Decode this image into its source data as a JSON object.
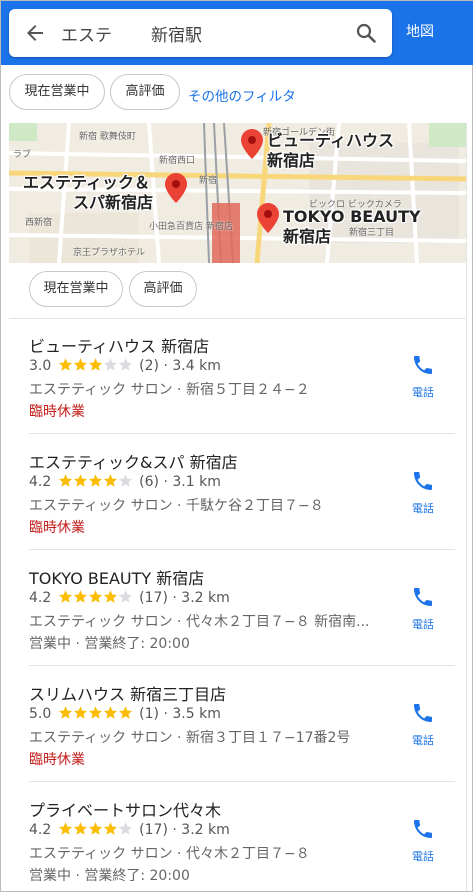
{
  "search": {
    "term": "エステ",
    "location": "新宿駅",
    "map_button": "地図"
  },
  "filters": {
    "open_now": "現在営業中",
    "top_rated": "高評価",
    "more": "その他のフィルタ"
  },
  "map": {
    "pins": [
      {
        "name": "ビューティハウス 新宿店",
        "line1": "ビューティハウス",
        "line2": "新宿店"
      },
      {
        "name": "エステティック＆ スパ新宿店",
        "line1": "エステティック＆",
        "line2": "スパ新宿店"
      },
      {
        "name": "TOKYO BEAUTY 新宿店",
        "line1": "TOKYO BEAUTY",
        "line2": "新宿店"
      }
    ],
    "labels": [
      "新宿ゴールデン街",
      "ビックロ ビックカメラ",
      "新宿三丁目",
      "新宿西口",
      "新宿",
      "京王プラザホテル",
      "西新宿",
      "小田急百貨店 新宿店",
      "新宿 歌舞伎町",
      "ラブ"
    ]
  },
  "map_filters": {
    "open_now": "現在営業中",
    "top_rated": "高評価"
  },
  "results": [
    {
      "name": "ビューティハウス 新宿店",
      "rating": "3.0",
      "rating_value": 3.0,
      "reviews": "(2)",
      "distance": "3.4 km",
      "category": "エステティック サロン · 新宿５丁目２４−２",
      "status": "臨時休業",
      "closed": true,
      "call": "電話"
    },
    {
      "name": "エステティック&スパ 新宿店",
      "rating": "4.2",
      "rating_value": 4.2,
      "reviews": "(6)",
      "distance": "3.1 km",
      "category": "エステティック サロン · 千駄ケ谷２丁目７−８",
      "status": "臨時休業",
      "closed": true,
      "call": "電話"
    },
    {
      "name": "TOKYO BEAUTY  新宿店",
      "rating": "4.2",
      "rating_value": 4.2,
      "reviews": "(17)",
      "distance": "3.2 km",
      "category": "エステティック サロン · 代々木２丁目７−８ 新宿南...",
      "status": "営業中 · 営業終了: 20:00",
      "closed": false,
      "call": "電話"
    },
    {
      "name": "スリムハウス 新宿三丁目店",
      "rating": "5.0",
      "rating_value": 5.0,
      "reviews": "(1)",
      "distance": "3.5 km",
      "category": "エステティック サロン · 新宿３丁目１７−17番2号",
      "status": "臨時休業",
      "closed": true,
      "call": "電話"
    },
    {
      "name": "プライベートサロン代々木",
      "rating": "4.2",
      "rating_value": 4.2,
      "reviews": "(17)",
      "distance": "3.2 km",
      "category": "エステティック サロン · 代々木２丁目７−８",
      "status": "営業中 · 営業終了: 20:00",
      "closed": false,
      "call": "電話"
    }
  ],
  "colors": {
    "accent": "#1a73e8",
    "star": "#fbbc04",
    "closed": "#c5221f",
    "pin": "#ea4335"
  }
}
